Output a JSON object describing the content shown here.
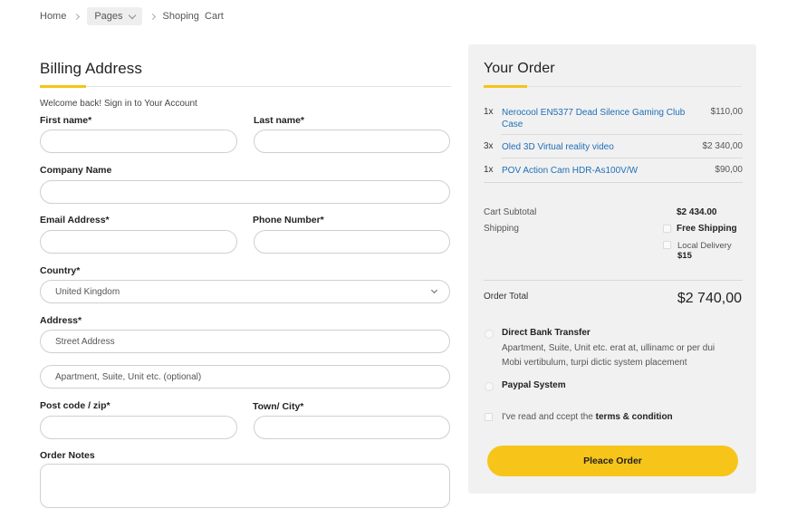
{
  "breadcrumb": {
    "home": "Home",
    "pages": "Pages",
    "current": "Shoping  Cart"
  },
  "billing": {
    "title": "Billing Address",
    "welcome": "Welcome back! Sign in to Your Account",
    "first_name_label": "First name*",
    "last_name_label": "Last name*",
    "company_label": "Company Name",
    "email_label": "Email Address*",
    "phone_label": "Phone Number*",
    "country_label": "Country*",
    "country_value": "United Kingdom",
    "address_label": "Address*",
    "address_placeholder": "Street Address",
    "apartment_placeholder": "Apartment, Suite, Unit etc. (optional)",
    "postcode_label": "Post code / zip*",
    "town_label": "Town/ City*",
    "notes_label": "Order Notes"
  },
  "order": {
    "title": "Your Order",
    "items": [
      {
        "qty": "1x",
        "name": "Nerocool EN5377 Dead Silence Gaming Club Case",
        "price": "$110,00"
      },
      {
        "qty": "3x",
        "name": "Oled 3D Virtual reality video",
        "price": "$2 340,00"
      },
      {
        "qty": "1x",
        "name": "POV Action Cam HDR-As100V/W",
        "price": "$90,00"
      }
    ],
    "subtotal_label": "Cart Subtotal",
    "subtotal_value": "$2 434.00",
    "shipping_label": "Shipping",
    "free_shipping": "Free Shipping",
    "local_delivery": "Local Delivery",
    "local_delivery_price": "$15",
    "total_label": "Order Total",
    "total_value": "$2 740,00",
    "payment_bank_title": "Direct Bank Transfer",
    "payment_bank_desc_1": "Apartment, Suite, Unit etc. erat at, ullinamc or per dui",
    "payment_bank_desc_2": "Mobi vertibulum, turpi dictic system placement",
    "payment_paypal": "Paypal System",
    "terms_prefix": "I've read and ccept the",
    "terms_link": "terms & condition",
    "place_order": "Pleace Order"
  },
  "colors": {
    "accent": "#f5c518",
    "button": "#f7c51a",
    "link": "#1f6fb8",
    "panel_bg": "#f1f1f1"
  }
}
